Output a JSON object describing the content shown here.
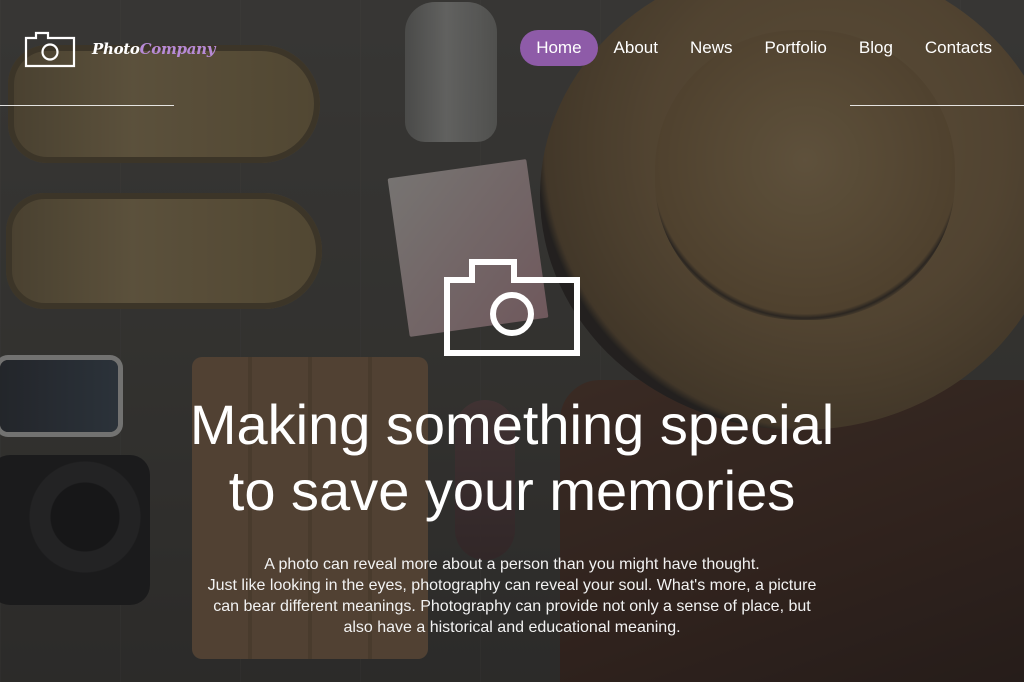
{
  "brand": {
    "name_part1": "Photo",
    "name_part2": "Company",
    "accent": "#8e5ba8",
    "name_accent": "#b78ad6",
    "icon": "camera-icon"
  },
  "nav": {
    "items": [
      {
        "label": "Home",
        "active": true
      },
      {
        "label": "About",
        "active": false
      },
      {
        "label": "News",
        "active": false
      },
      {
        "label": "Portfolio",
        "active": false
      },
      {
        "label": "Blog",
        "active": false
      },
      {
        "label": "Contacts",
        "active": false
      }
    ]
  },
  "hero": {
    "icon": "camera-icon",
    "headline_line1": "Making something special",
    "headline_line2": "to save your memories",
    "paragraph_line1": "A photo can reveal more about a person than you might have thought.",
    "paragraph_line2": "Just like looking in the eyes, photography can reveal your soul. What's more, a picture",
    "paragraph_line3": "can bear different meanings. Photography can provide not only a sense of place, but",
    "paragraph_line4": "also have a historical and educational meaning."
  }
}
